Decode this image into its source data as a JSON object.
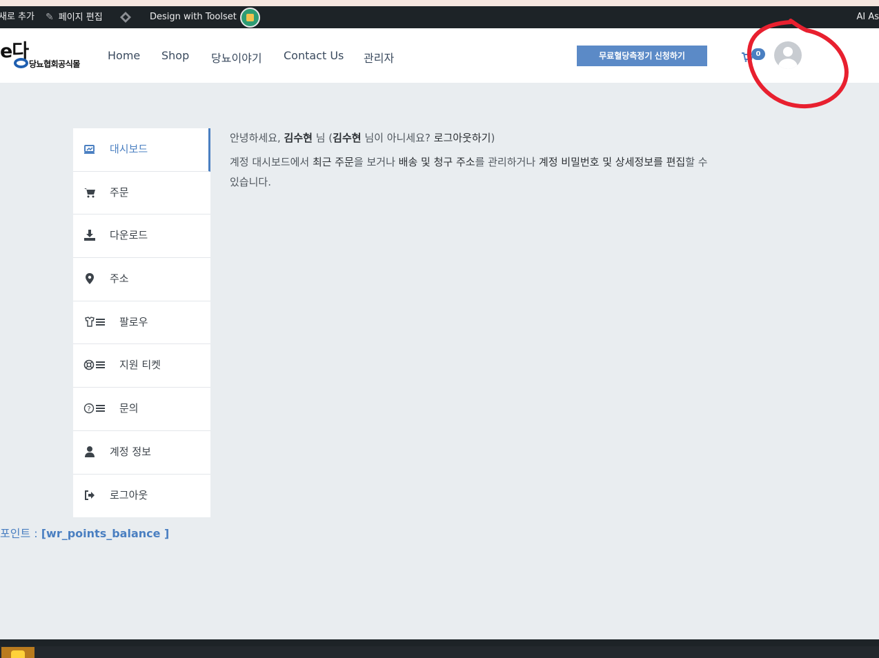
{
  "admin_bar": {
    "new_label": "새로 추가",
    "edit_label": "페이지 편집",
    "design_label": "Design with Toolset",
    "ai_label": "AI As"
  },
  "header": {
    "logo_text": "e다",
    "logo_sub": "당뇨협회공식몰",
    "nav": [
      "Home",
      "Shop",
      "당뇨이야기",
      "Contact Us",
      "관리자"
    ],
    "cta_label": "무료혈당측정기 신청하기",
    "cart_count": "0"
  },
  "sidebar": {
    "items": [
      {
        "label": "대시보드",
        "icon": "dashboard-icon",
        "active": true
      },
      {
        "label": "주문",
        "icon": "cart-icon",
        "active": false
      },
      {
        "label": "다운로드",
        "icon": "download-icon",
        "active": false
      },
      {
        "label": "주소",
        "icon": "map-pin-icon",
        "active": false
      },
      {
        "label": "팔로우",
        "icon": "follow-list-icon",
        "active": false
      },
      {
        "label": "지원 티켓",
        "icon": "support-ticket-icon",
        "active": false
      },
      {
        "label": "문의",
        "icon": "inquiry-icon",
        "active": false
      },
      {
        "label": "계정 정보",
        "icon": "user-icon",
        "active": false
      },
      {
        "label": "로그아웃",
        "icon": "logout-icon",
        "active": false
      }
    ]
  },
  "content": {
    "greet_prefix": "안녕하세요, ",
    "user_name": "김수현",
    "greet_mid": " 님 (",
    "user_name2": "김수현",
    "greet_mid2": " 님이 아니세요? ",
    "logout_link": "로그아웃하기",
    "greet_suffix": ")",
    "desc_1": "계정 대시보드에서 ",
    "link_orders": "최근 주문",
    "desc_2": "을 보거나 ",
    "link_addresses": "배송 및 청구 주소",
    "desc_3": "를 관리하거나 ",
    "link_account": "계정 비밀번호 및 상세정보를 편집",
    "desc_4": "할 수 있습니다."
  },
  "points": {
    "label": "포인트 : ",
    "value": "[wr_points_balance ]"
  },
  "colors": {
    "accent": "#4a7fc1",
    "admin_bar": "#1d2327",
    "page_bg": "#e9edf0",
    "annotation": "#e8202f"
  }
}
